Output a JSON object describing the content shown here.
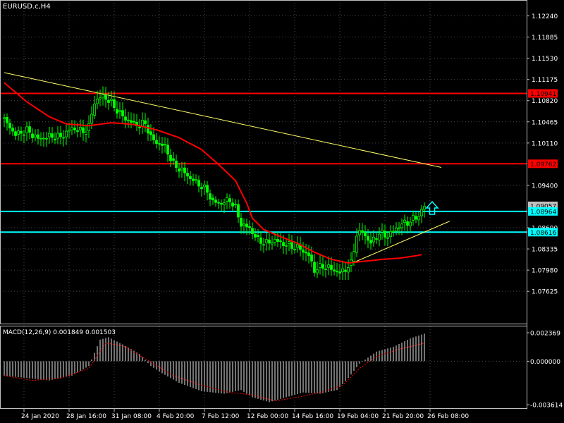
{
  "chart_data": {
    "type": "candlestick",
    "symbol": "EURUSD.c,H4",
    "colors": {
      "background": "#000000",
      "candles": "#00ff00",
      "grid": "#4a4a4a",
      "moving_average": "#ff0000",
      "trendline": "#ffff66",
      "resistance": "#ff0000",
      "support": "#00ffff",
      "macd_histogram": "#c0c0c0",
      "macd_signal": "#ff0000",
      "axis_text": "#ffffff"
    },
    "price_axis": {
      "range": [
        1.0745,
        1.124
      ],
      "ticks": [
        "1.12240",
        "1.11885",
        "1.11530",
        "1.11175",
        "1.10820",
        "1.10465",
        "1.10110",
        "1.09400",
        "1.08690",
        "1.08335",
        "1.07980",
        "1.07625"
      ]
    },
    "price_labels": [
      {
        "text": "1.10941",
        "price": 1.10941,
        "color": "#ff0000",
        "text_color": "#000000"
      },
      {
        "text": "1.09762",
        "price": 1.09762,
        "color": "#ff0000",
        "text_color": "#000000"
      },
      {
        "text": "1.09057",
        "price": 1.09057,
        "color": "#c0c0c0",
        "text_color": "#000000"
      },
      {
        "text": "1.08964",
        "price": 1.08964,
        "color": "#00ffff",
        "text_color": "#000000"
      },
      {
        "text": "1.08616",
        "price": 1.08616,
        "color": "#00ffff",
        "text_color": "#000000"
      }
    ],
    "horizontal_lines": [
      {
        "price": 1.10941,
        "color": "#ff0000"
      },
      {
        "price": 1.09762,
        "color": "#ff0000"
      },
      {
        "price": 1.08964,
        "color": "#00ffff"
      },
      {
        "price": 1.08616,
        "color": "#00ffff"
      }
    ],
    "trendlines": [
      {
        "from": [
          0,
          1.1129
        ],
        "to": [
          155,
          1.097
        ]
      },
      {
        "from": [
          124,
          1.0811
        ],
        "to": [
          158,
          1.088
        ]
      }
    ],
    "time_labels": [
      {
        "text": "24 Jan 2020",
        "bar": 7
      },
      {
        "text": "28 Jan 16:00",
        "bar": 23
      },
      {
        "text": "31 Jan 08:00",
        "bar": 39
      },
      {
        "text": "4 Feb 20:00",
        "bar": 55
      },
      {
        "text": "7 Feb 12:00",
        "bar": 71
      },
      {
        "text": "12 Feb 00:00",
        "bar": 87
      },
      {
        "text": "14 Feb 16:00",
        "bar": 103
      },
      {
        "text": "19 Feb 04:00",
        "bar": 119
      },
      {
        "text": "21 Feb 20:00",
        "bar": 135
      },
      {
        "text": "26 Feb 08:00",
        "bar": 151
      }
    ],
    "close_anchors": [
      [
        0,
        1.105
      ],
      [
        4,
        1.1025
      ],
      [
        8,
        1.1032
      ],
      [
        12,
        1.1018
      ],
      [
        16,
        1.1022
      ],
      [
        20,
        1.1021
      ],
      [
        24,
        1.1036
      ],
      [
        28,
        1.103
      ],
      [
        30,
        1.1038
      ],
      [
        32,
        1.108
      ],
      [
        35,
        1.109
      ],
      [
        38,
        1.1078
      ],
      [
        41,
        1.106
      ],
      [
        44,
        1.1048
      ],
      [
        48,
        1.104
      ],
      [
        50,
        1.1045
      ],
      [
        52,
        1.102
      ],
      [
        54,
        1.1012
      ],
      [
        57,
        1.1005
      ],
      [
        60,
        1.0975
      ],
      [
        63,
        1.0965
      ],
      [
        66,
        1.0952
      ],
      [
        69,
        1.0942
      ],
      [
        72,
        1.093
      ],
      [
        74,
        1.0912
      ],
      [
        77,
        1.091
      ],
      [
        80,
        1.0916
      ],
      [
        82,
        1.0902
      ],
      [
        84,
        1.0875
      ],
      [
        87,
        1.0868
      ],
      [
        90,
        1.0848
      ],
      [
        93,
        1.0843
      ],
      [
        96,
        1.0848
      ],
      [
        99,
        1.0842
      ],
      [
        102,
        1.0838
      ],
      [
        105,
        1.0834
      ],
      [
        108,
        1.0822
      ],
      [
        110,
        1.0798
      ],
      [
        113,
        1.0805
      ],
      [
        116,
        1.08
      ],
      [
        119,
        1.0793
      ],
      [
        121,
        1.08
      ],
      [
        123,
        1.0808
      ],
      [
        125,
        1.0858
      ],
      [
        127,
        1.0862
      ],
      [
        130,
        1.0843
      ],
      [
        133,
        1.086
      ],
      [
        136,
        1.0855
      ],
      [
        139,
        1.0868
      ],
      [
        141,
        1.0875
      ],
      [
        144,
        1.088
      ],
      [
        147,
        1.089
      ],
      [
        149,
        1.0905
      ]
    ],
    "ma_anchors": [
      [
        0,
        1.1112
      ],
      [
        8,
        1.108
      ],
      [
        16,
        1.1055
      ],
      [
        22,
        1.1043
      ],
      [
        30,
        1.104
      ],
      [
        38,
        1.1045
      ],
      [
        46,
        1.1042
      ],
      [
        54,
        1.1033
      ],
      [
        62,
        1.102
      ],
      [
        70,
        1.1
      ],
      [
        76,
        1.0975
      ],
      [
        82,
        1.0948
      ],
      [
        86,
        1.091
      ],
      [
        88,
        1.0885
      ],
      [
        92,
        1.0866
      ],
      [
        98,
        1.0854
      ],
      [
        104,
        1.0843
      ],
      [
        110,
        1.0828
      ],
      [
        116,
        1.0816
      ],
      [
        122,
        1.081
      ],
      [
        128,
        1.0813
      ],
      [
        134,
        1.0816
      ],
      [
        140,
        1.0818
      ],
      [
        146,
        1.0822
      ],
      [
        148,
        1.0824
      ]
    ],
    "macd": {
      "label": "MACD(12,26,9) 0.001849 0.001503",
      "axis_ticks": [
        "0.002369",
        "0.000000",
        "-0.003614"
      ],
      "range": [
        -0.003614,
        0.002369
      ],
      "hist_anchors": [
        [
          0,
          -0.0012
        ],
        [
          8,
          -0.0014
        ],
        [
          16,
          -0.0016
        ],
        [
          24,
          -0.0012
        ],
        [
          30,
          -0.0004
        ],
        [
          34,
          0.0018
        ],
        [
          37,
          0.002
        ],
        [
          42,
          0.0014
        ],
        [
          48,
          0.0006
        ],
        [
          52,
          -0.0004
        ],
        [
          56,
          -0.001
        ],
        [
          62,
          -0.0018
        ],
        [
          70,
          -0.0025
        ],
        [
          78,
          -0.0027
        ],
        [
          84,
          -0.0024
        ],
        [
          88,
          -0.003
        ],
        [
          94,
          -0.0034
        ],
        [
          100,
          -0.003
        ],
        [
          106,
          -0.0026
        ],
        [
          112,
          -0.0027
        ],
        [
          118,
          -0.0024
        ],
        [
          122,
          -0.0014
        ],
        [
          126,
          -0.0002
        ],
        [
          132,
          0.0008
        ],
        [
          138,
          0.0012
        ],
        [
          144,
          0.0019
        ],
        [
          149,
          0.0023
        ]
      ],
      "signal_anchors": [
        [
          0,
          -0.0012
        ],
        [
          10,
          -0.0016
        ],
        [
          20,
          -0.0014
        ],
        [
          30,
          -0.0006
        ],
        [
          36,
          0.0015
        ],
        [
          42,
          0.0013
        ],
        [
          50,
          0.0002
        ],
        [
          60,
          -0.0012
        ],
        [
          70,
          -0.002
        ],
        [
          80,
          -0.0026
        ],
        [
          88,
          -0.0028
        ],
        [
          96,
          -0.0033
        ],
        [
          104,
          -0.003
        ],
        [
          112,
          -0.0026
        ],
        [
          120,
          -0.002
        ],
        [
          126,
          -0.0006
        ],
        [
          132,
          0.0004
        ],
        [
          140,
          0.001
        ],
        [
          149,
          0.0015
        ]
      ]
    }
  }
}
